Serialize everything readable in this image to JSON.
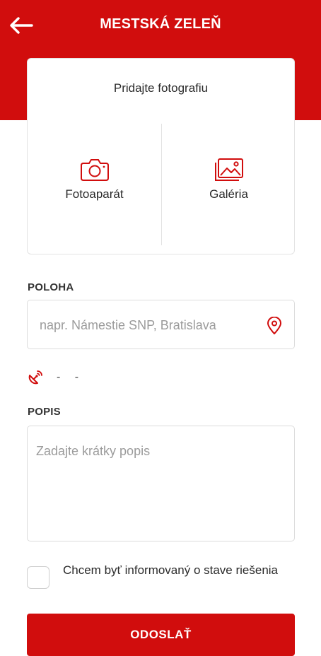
{
  "colors": {
    "brand_red": "#d10d0d",
    "card_border": "#e3e3e3",
    "placeholder": "#9b9b9b"
  },
  "header": {
    "title": "MESTSKÁ ZELEŇ",
    "back_icon": "arrow-left-icon"
  },
  "photo": {
    "title": "Pridajte fotografiu",
    "options": [
      {
        "label": "Fotoaparát",
        "icon": "camera-icon"
      },
      {
        "label": "Galéria",
        "icon": "gallery-icon"
      }
    ]
  },
  "location": {
    "label": "POLOHA",
    "placeholder": "napr. Námestie SNP, Bratislava",
    "value": "",
    "pin_icon": "location-pin-icon"
  },
  "gps": {
    "icon": "satellite-dish-icon",
    "text": "- -"
  },
  "description": {
    "label": "POPIS",
    "placeholder": "Zadajte krátky popis",
    "value": ""
  },
  "notify": {
    "label": "Chcem byť informovaný o stave riešenia",
    "checked": false
  },
  "submit": {
    "label": "ODOSLAŤ"
  }
}
